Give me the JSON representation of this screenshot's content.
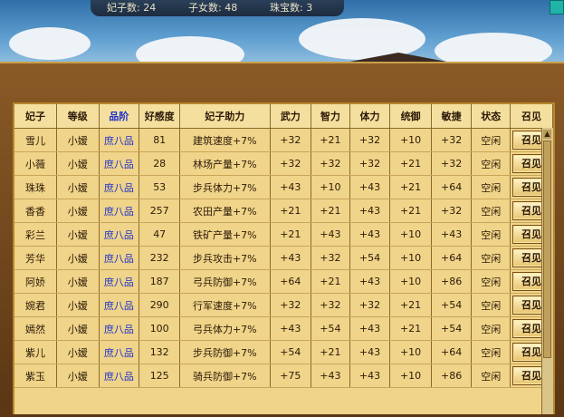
{
  "status": {
    "concubines": "妃子数: 24",
    "children": "子女数: 48",
    "jewels": "珠宝数: 3"
  },
  "table": {
    "headers": [
      "妃子",
      "等级",
      "品阶",
      "好感度",
      "妃子助力",
      "武力",
      "智力",
      "体力",
      "统御",
      "敏捷",
      "状态",
      "召见"
    ],
    "summon_label": "召见",
    "rows": [
      [
        "雪儿",
        "小嫒",
        "庶八品",
        "81",
        "建筑速度+7%",
        "+32",
        "+21",
        "+32",
        "+10",
        "+32",
        "空闲"
      ],
      [
        "小薇",
        "小嫒",
        "庶八品",
        "28",
        "林场产量+7%",
        "+32",
        "+32",
        "+32",
        "+21",
        "+32",
        "空闲"
      ],
      [
        "珠珠",
        "小嫒",
        "庶八品",
        "53",
        "步兵体力+7%",
        "+43",
        "+10",
        "+43",
        "+21",
        "+64",
        "空闲"
      ],
      [
        "香香",
        "小嫒",
        "庶八品",
        "257",
        "农田产量+7%",
        "+21",
        "+21",
        "+43",
        "+21",
        "+32",
        "空闲"
      ],
      [
        "彩兰",
        "小嫒",
        "庶八品",
        "47",
        "铁矿产量+7%",
        "+21",
        "+43",
        "+43",
        "+10",
        "+43",
        "空闲"
      ],
      [
        "芳华",
        "小嫒",
        "庶八品",
        "232",
        "步兵攻击+7%",
        "+43",
        "+32",
        "+54",
        "+10",
        "+64",
        "空闲"
      ],
      [
        "阿娇",
        "小嫒",
        "庶八品",
        "187",
        "弓兵防御+7%",
        "+64",
        "+21",
        "+43",
        "+10",
        "+86",
        "空闲"
      ],
      [
        "婉君",
        "小嫒",
        "庶八品",
        "290",
        "行军速度+7%",
        "+32",
        "+32",
        "+32",
        "+21",
        "+54",
        "空闲"
      ],
      [
        "嫣然",
        "小嫒",
        "庶八品",
        "100",
        "弓兵体力+7%",
        "+43",
        "+54",
        "+43",
        "+21",
        "+54",
        "空闲"
      ],
      [
        "紫儿",
        "小嫒",
        "庶八品",
        "132",
        "步兵防御+7%",
        "+54",
        "+21",
        "+43",
        "+10",
        "+64",
        "空闲"
      ],
      [
        "紫玉",
        "小嫒",
        "庶八品",
        "125",
        "骑兵防御+7%",
        "+75",
        "+43",
        "+43",
        "+10",
        "+86",
        "空闲"
      ]
    ]
  },
  "colors": {
    "grade": "#1b2fd0",
    "panel": "#f0d489",
    "frame": "#6b4219"
  },
  "icons": {
    "scroll_up": "arrow-up-icon"
  }
}
